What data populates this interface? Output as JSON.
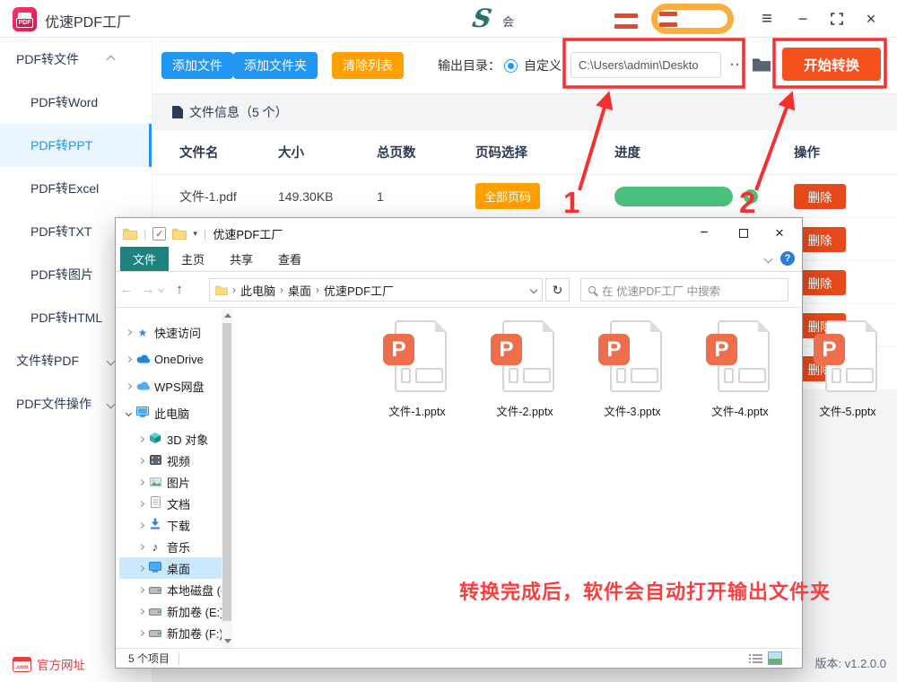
{
  "colors": {
    "accent_blue": "#2196F3",
    "amber": "#FFA000",
    "start_orange": "#F4511E",
    "delete_red": "#E8491B",
    "progress_green": "#4CC17E",
    "annotation_red": "#F53030",
    "explorer_tab_teal": "#1E837E",
    "tree_selection_blue": "#CCE8FF",
    "brand_pink": "#E1134E"
  },
  "titlebar": {
    "logo_text": "PDF",
    "app_title": "优速PDF工厂",
    "center_char": "会"
  },
  "sidebar": {
    "items": [
      {
        "label": "PDF转文件"
      },
      {
        "label": "PDF转Word"
      },
      {
        "label": "PDF转PPT"
      },
      {
        "label": "PDF转Excel"
      },
      {
        "label": "PDF转TXT"
      },
      {
        "label": "PDF转图片"
      },
      {
        "label": "PDF转HTML"
      },
      {
        "label": "文件转PDF"
      },
      {
        "label": "PDF文件操作"
      }
    ],
    "selected": "PDF转PPT"
  },
  "toolbar": {
    "add_file": "添加文件",
    "add_folder": "添加文件夹",
    "clear_list": "清除列表",
    "output_dir_label": "输出目录：",
    "custom_option": "自定义",
    "output_path": "C:\\Users\\admin\\Deskto",
    "more_button": "···",
    "start_button": "开始转换"
  },
  "files_panel": {
    "title": "文件信息（5 个）"
  },
  "table": {
    "headers": [
      "文件名",
      "大小",
      "总页数",
      "页码选择",
      "进度",
      "操作"
    ],
    "row1": {
      "name": "文件-1.pdf",
      "size": "149.30KB",
      "pages": "1",
      "page_select": "全部页码",
      "progress_percent": 100,
      "action": "删除"
    },
    "more_rows_action": "删除"
  },
  "footer": {
    "com_badge": ".com",
    "official_site": "官方网址",
    "version": "版本: v1.2.0.0"
  },
  "explorer": {
    "title": "优速PDF工厂",
    "tabs": [
      "文件",
      "主页",
      "共享",
      "查看"
    ],
    "breadcrumb": [
      "此电脑",
      "桌面",
      "优速PDF工厂"
    ],
    "search_placeholder": "在 优速PDF工厂 中搜索",
    "tree": [
      {
        "label": "快速访问"
      },
      {
        "label": "OneDrive"
      },
      {
        "label": "WPS网盘"
      },
      {
        "label": "此电脑"
      },
      {
        "label": "3D 对象"
      },
      {
        "label": "视频"
      },
      {
        "label": "图片"
      },
      {
        "label": "文档"
      },
      {
        "label": "下载"
      },
      {
        "label": "音乐"
      },
      {
        "label": "桌面"
      },
      {
        "label": "本地磁盘 (C:"
      },
      {
        "label": "新加卷 (E:)"
      },
      {
        "label": "新加卷 (F:)"
      }
    ],
    "selected_tree_item": "桌面",
    "files": [
      {
        "name": "文件-1.pptx"
      },
      {
        "name": "文件-2.pptx"
      },
      {
        "name": "文件-3.pptx"
      },
      {
        "name": "文件-4.pptx"
      },
      {
        "name": "文件-5.pptx"
      }
    ],
    "file_badge": "P",
    "status": "5 个项目"
  },
  "annotations": {
    "label1": "1",
    "label2": "2",
    "note": "转换完成后，软件会自动打开输出文件夹"
  }
}
